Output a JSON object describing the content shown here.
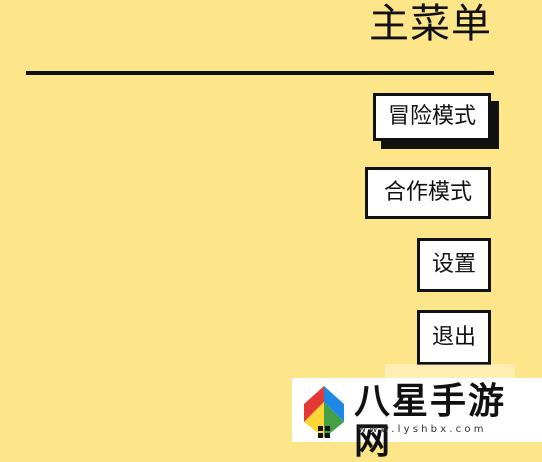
{
  "header": {
    "title": "主菜单"
  },
  "menu": {
    "adventure_label": "冒险模式",
    "coop_label": "合作模式",
    "settings_label": "设置",
    "exit_label": "退出",
    "selected": "adventure"
  },
  "watermark": {
    "brand": "八星手游网",
    "url": "www.lyshbx.com",
    "logo_colors": [
      "#e53935",
      "#fdd835",
      "#43a047",
      "#1e88e5"
    ]
  },
  "colors": {
    "background": "#fde58a",
    "ink": "#111111",
    "button_bg": "#ffffff"
  }
}
